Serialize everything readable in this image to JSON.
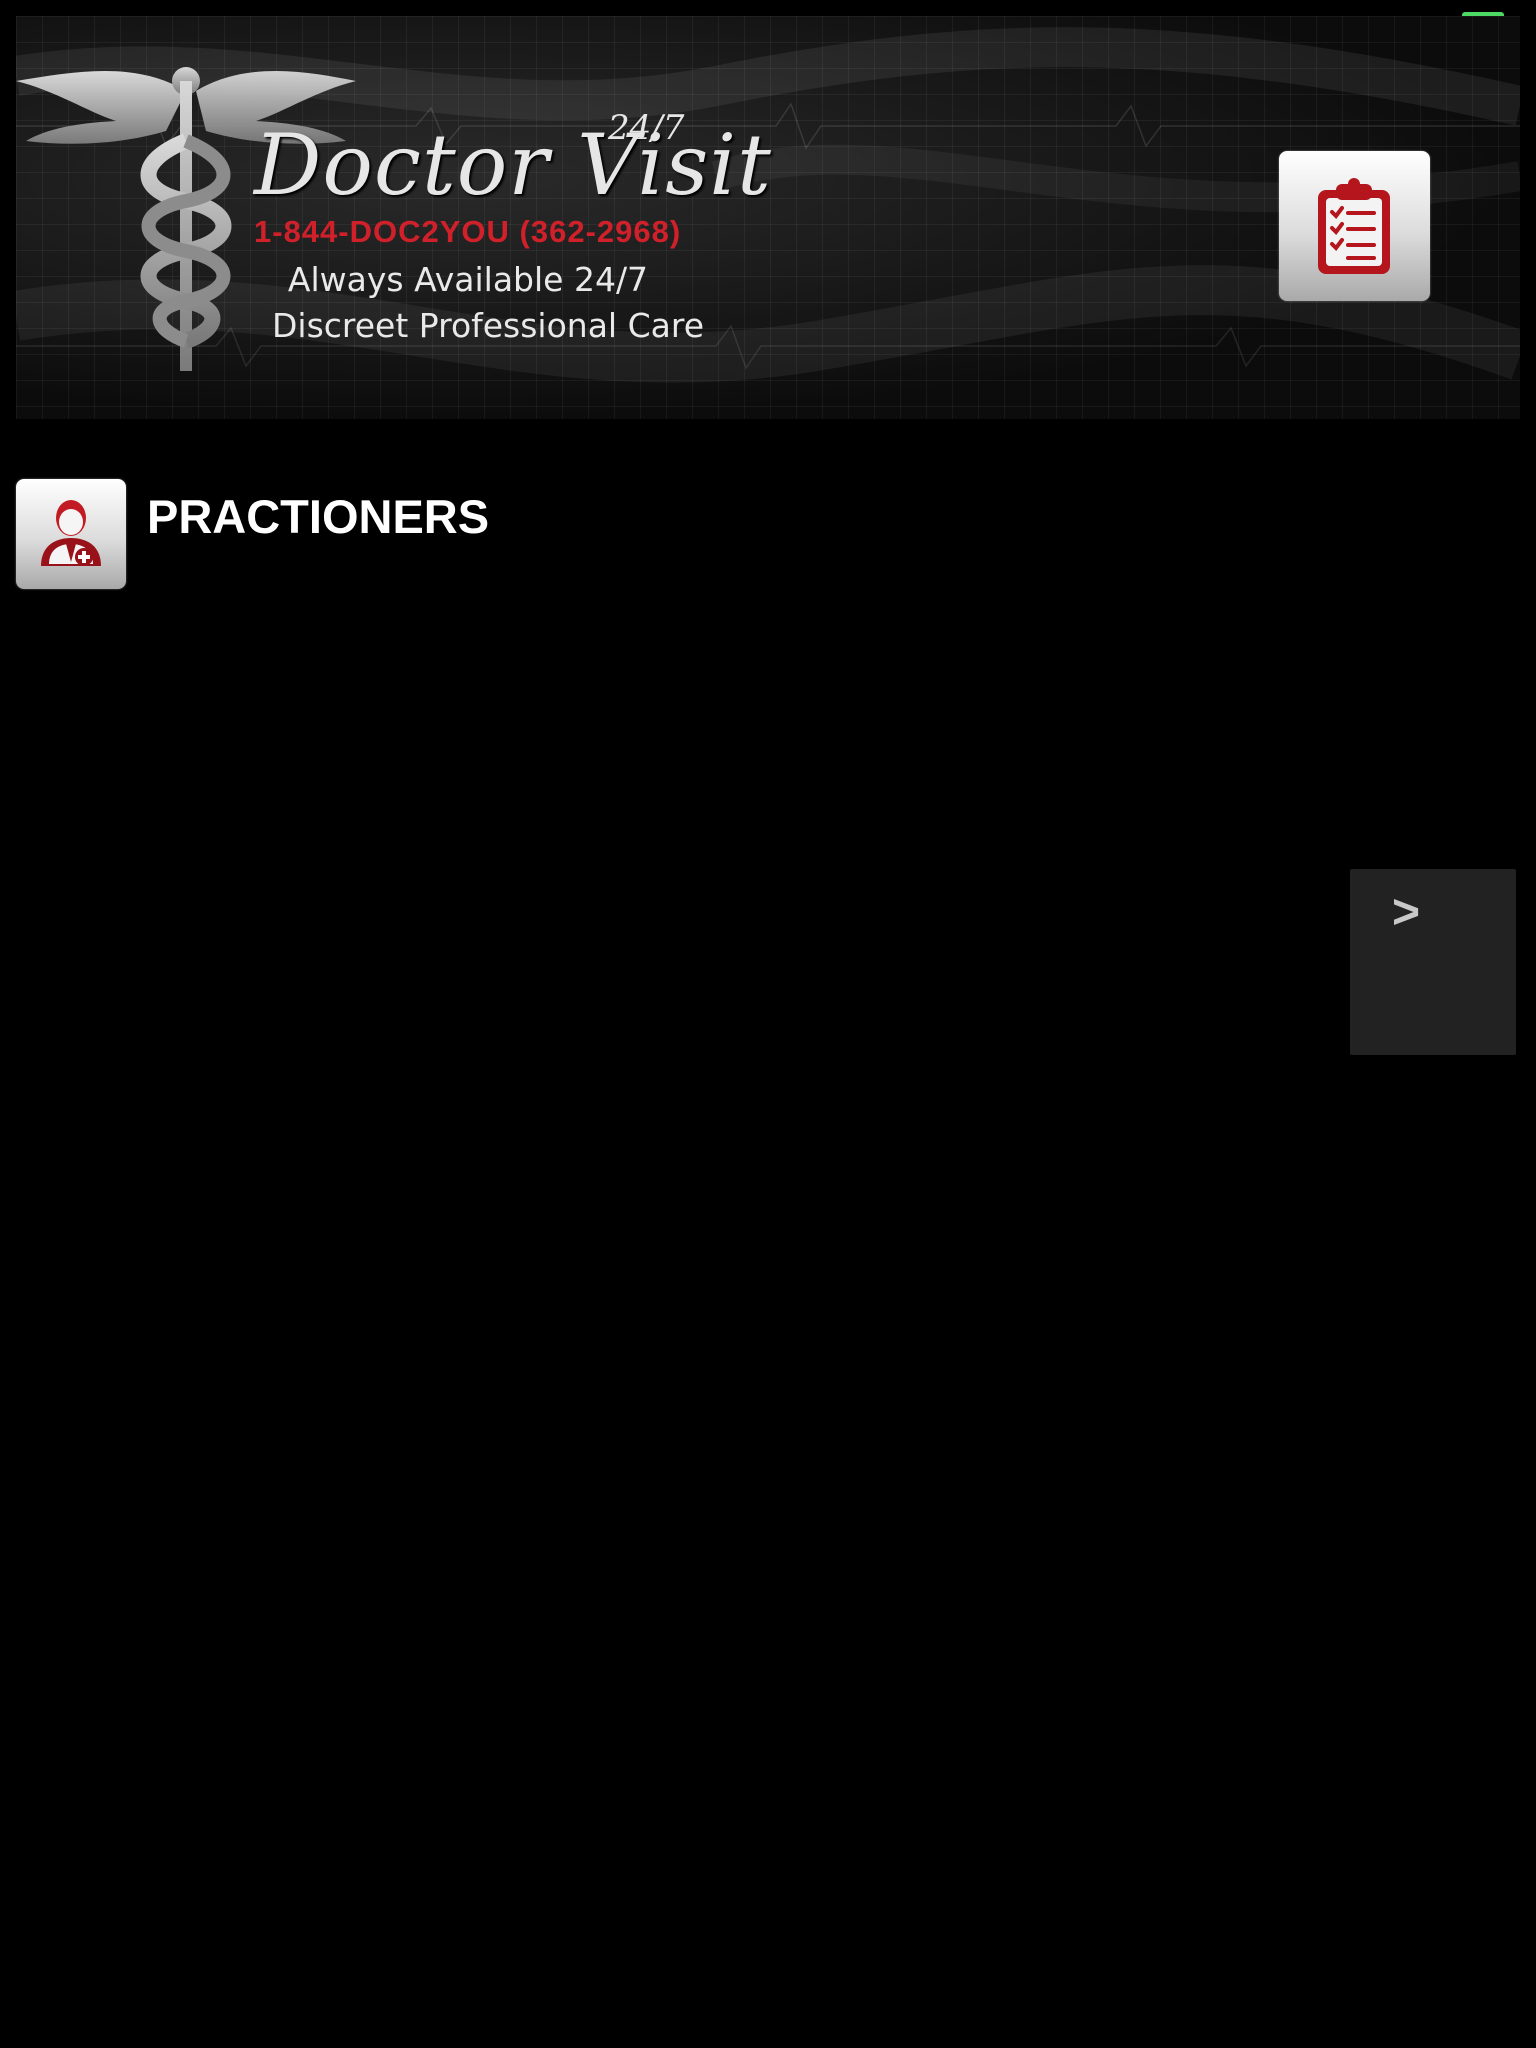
{
  "status": {
    "indicator_color": "#4cd964"
  },
  "banner": {
    "title": "Doctor Visit",
    "title_superscript": "24/7",
    "phone": "1-844-DOC2YOU (362-2968)",
    "tagline_1": "Always Available 24/7",
    "tagline_2": "Discreet Professional Care",
    "caduceus_icon": "caduceus-icon",
    "accent_color": "#d0202a"
  },
  "toolbar": {
    "clipboard_icon": "clipboard-checklist-icon"
  },
  "section": {
    "icon": "doctor-icon",
    "title": "PRACTIONERS"
  },
  "pager": {
    "next_label": ">"
  }
}
